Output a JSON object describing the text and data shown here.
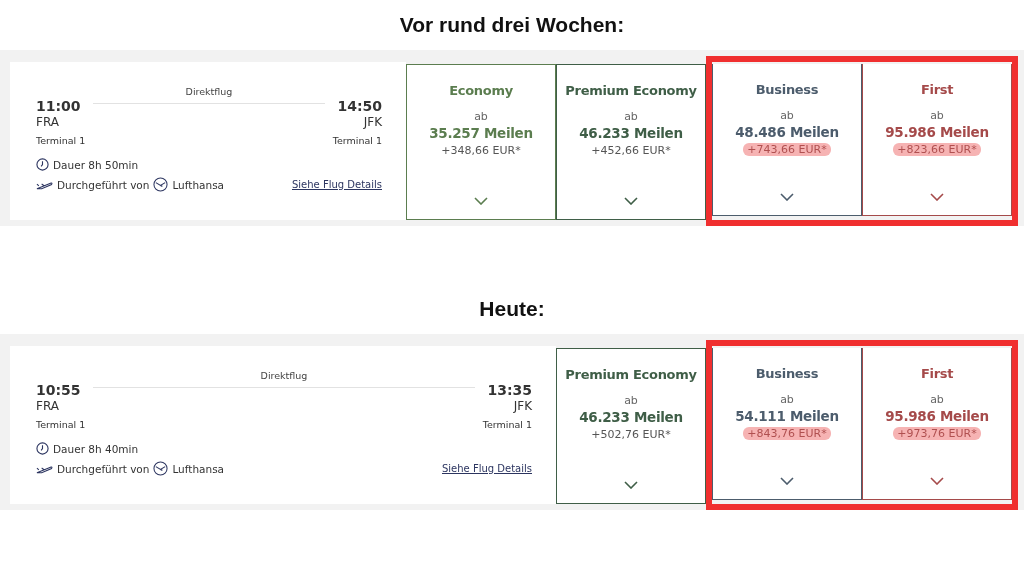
{
  "sections": [
    {
      "heading": "Vor rund drei Wochen:",
      "flight": {
        "label": "Direktflug",
        "departure": {
          "time": "11:00",
          "airport": "FRA",
          "terminal": "Terminal 1"
        },
        "arrival": {
          "time": "14:50",
          "airport": "JFK",
          "terminal": "Terminal 1"
        },
        "duration": "Dauer 8h 50min",
        "operated_by": "Durchgeführt von",
        "airline": "Lufthansa",
        "details_link": "Siehe Flug Details"
      },
      "fares": [
        {
          "color": "#5b7d4f",
          "name": "Economy",
          "from": "ab",
          "miles": "35.257 Meilen",
          "surcharge": "+348,66 EUR*",
          "highlighted": false
        },
        {
          "color": "#3f5e47",
          "name": "Premium Economy",
          "from": "ab",
          "miles": "46.233 Meilen",
          "surcharge": "+452,66 EUR*",
          "highlighted": false
        },
        {
          "color": "#4c5c6c",
          "name": "Business",
          "from": "ab",
          "miles": "48.486 Meilen",
          "surcharge": "+743,66 EUR*",
          "highlighted": true
        },
        {
          "color": "#a54a4a",
          "name": "First",
          "from": "ab",
          "miles": "95.986 Meilen",
          "surcharge": "+823,66 EUR*",
          "highlighted": true
        }
      ]
    },
    {
      "heading": "Heute:",
      "flight": {
        "label": "Direktflug",
        "departure": {
          "time": "10:55",
          "airport": "FRA",
          "terminal": "Terminal 1"
        },
        "arrival": {
          "time": "13:35",
          "airport": "JFK",
          "terminal": "Terminal 1"
        },
        "duration": "Dauer 8h 40min",
        "operated_by": "Durchgeführt von",
        "airline": "Lufthansa",
        "details_link": "Siehe Flug Details"
      },
      "fares": [
        {
          "color": "#3f5e47",
          "name": "Premium Economy",
          "from": "ab",
          "miles": "46.233 Meilen",
          "surcharge": "+502,76 EUR*",
          "highlighted": false
        },
        {
          "color": "#4c5c6c",
          "name": "Business",
          "from": "ab",
          "miles": "54.111 Meilen",
          "surcharge": "+843,76 EUR*",
          "highlighted": true
        },
        {
          "color": "#a54a4a",
          "name": "First",
          "from": "ab",
          "miles": "95.986 Meilen",
          "surcharge": "+973,76 EUR*",
          "highlighted": true
        }
      ]
    }
  ]
}
